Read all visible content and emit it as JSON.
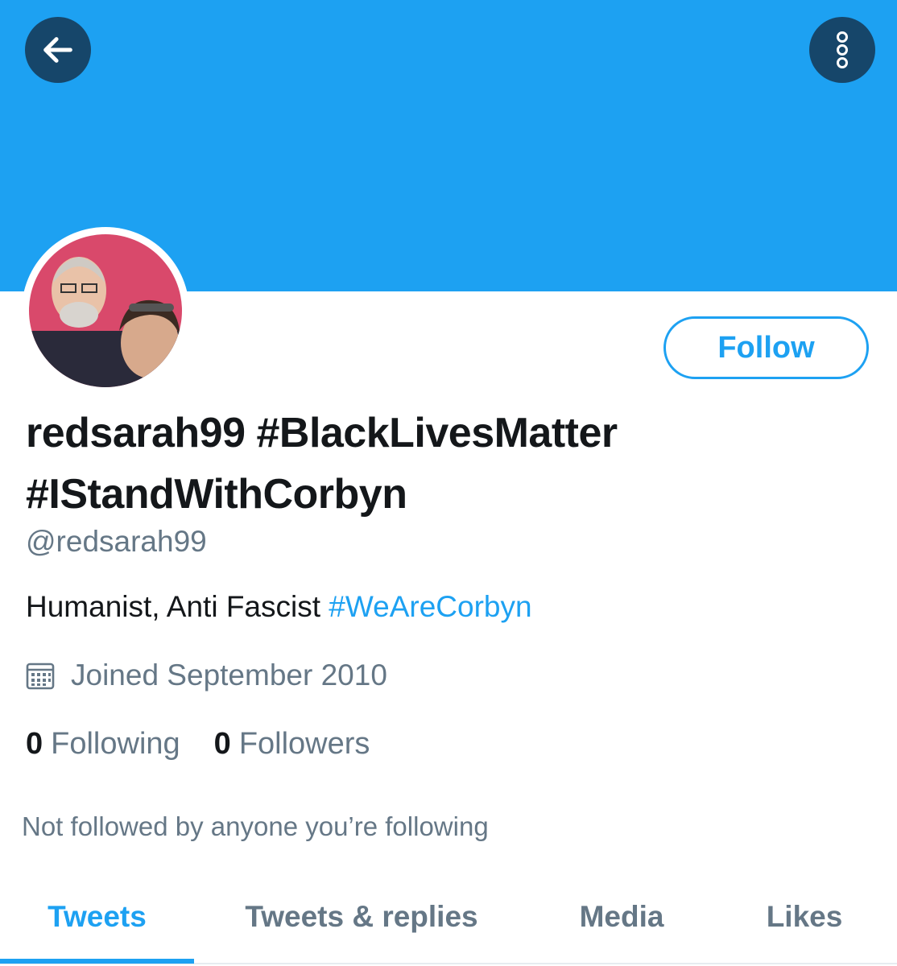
{
  "colors": {
    "banner": "#1da1f2",
    "accent": "#1da1f2",
    "button_dark": "#16466a",
    "text_primary": "#14171a",
    "text_secondary": "#657786"
  },
  "header": {
    "back_icon": "arrow-left-icon",
    "more_icon": "more-vertical-icon"
  },
  "profile": {
    "follow_label": "Follow",
    "display_name": "redsarah99 #BlackLivesMatter #IStandWithCorbyn",
    "handle": "@redsarah99",
    "bio_text": "Humanist, Anti Fascist",
    "bio_hashtag": "#WeAreCorbyn",
    "joined_icon": "calendar-icon",
    "joined": "Joined September 2010",
    "following_count": "0",
    "following_label": "Following",
    "followers_count": "0",
    "followers_label": "Followers",
    "not_followed": "Not followed by anyone you’re following"
  },
  "tabs": [
    {
      "label": "Tweets",
      "active": true
    },
    {
      "label": "Tweets & replies",
      "active": false
    },
    {
      "label": "Media",
      "active": false
    },
    {
      "label": "Likes",
      "active": false
    }
  ]
}
